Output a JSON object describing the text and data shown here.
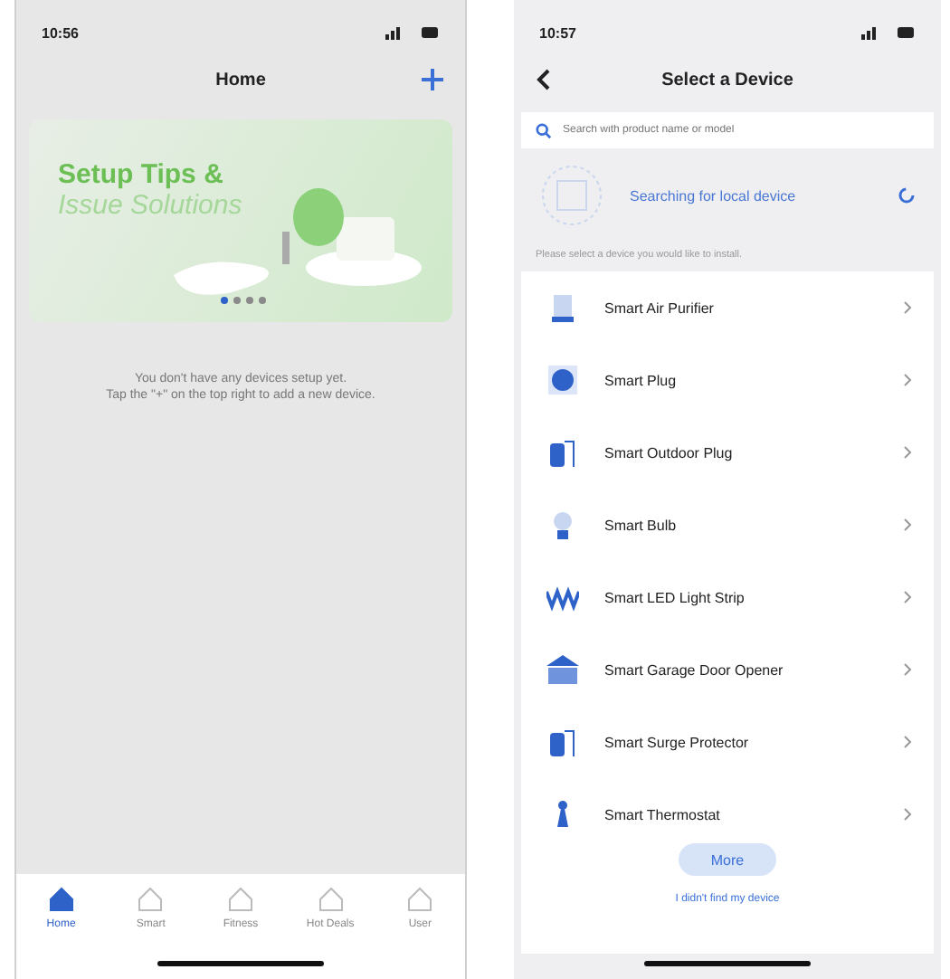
{
  "home_screen": {
    "status_bar": {
      "time": "10:56"
    },
    "title": "Home",
    "banner": {
      "title_line_1": "Setup Tips &",
      "title_line_2": "Issue Solutions",
      "dots": [
        {
          "selected": true
        },
        {
          "selected": false
        },
        {
          "selected": false
        },
        {
          "selected": false
        }
      ]
    },
    "empty_message": [
      "You don't have any devices setup yet.",
      "Tap the \"+\" on the top right to add a new device."
    ],
    "tab_bar": [
      {
        "label": "Home",
        "selected": true
      },
      {
        "label": "Smart",
        "selected": false
      },
      {
        "label": "Fitness",
        "selected": false
      },
      {
        "label": "Hot Deals",
        "selected": false
      },
      {
        "label": "User",
        "selected": false
      }
    ]
  },
  "select_device_screen": {
    "status_bar": {
      "time": "10:57"
    },
    "title": "Select a Device",
    "search": {
      "placeholder": "Search with product name or model"
    },
    "scanning_text": "Searching for local device",
    "hint": "Please select a device you would like to install.",
    "devices": [
      {
        "name": "Smart Air Purifier",
        "kind": "purifier"
      },
      {
        "name": "Smart Plug",
        "kind": "plug"
      },
      {
        "name": "Smart Outdoor Plug",
        "kind": "outdoor"
      },
      {
        "name": "Smart Bulb",
        "kind": "bulb"
      },
      {
        "name": "Smart LED Light Strip",
        "kind": "strip"
      },
      {
        "name": "Smart Garage Door Opener",
        "kind": "garage"
      },
      {
        "name": "Smart Surge Protector",
        "kind": "surge"
      },
      {
        "name": "Smart Thermostat",
        "kind": "thermostat"
      }
    ],
    "more_button": "More",
    "link": "I didn't find my device"
  }
}
